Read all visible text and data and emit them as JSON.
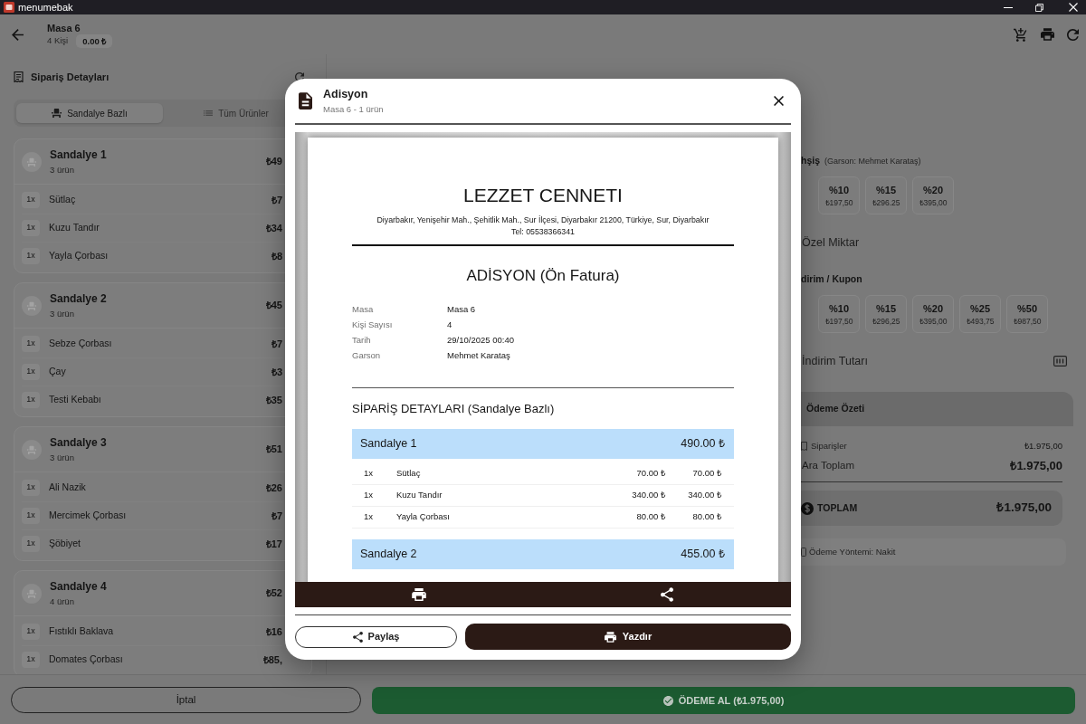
{
  "window": {
    "title": "menumebak"
  },
  "header": {
    "title": "Masa 6",
    "guests": "4 Kişi",
    "balance": "0.00 ₺"
  },
  "order_panel": {
    "title": "Sipariş Detayları",
    "tabs": [
      {
        "label": "Sandalye Bazlı",
        "selected": true
      },
      {
        "label": "Tüm Ürünler",
        "selected": false
      }
    ],
    "chairs": [
      {
        "name": "Sandalye 1",
        "count": "3 ürün",
        "total": "₺49",
        "items": [
          {
            "qty": "1x",
            "name": "Sütlaç",
            "price": "₺7"
          },
          {
            "qty": "1x",
            "name": "Kuzu Tandır",
            "price": "₺34"
          },
          {
            "qty": "1x",
            "name": "Yayla Çorbası",
            "price": "₺8"
          }
        ]
      },
      {
        "name": "Sandalye 2",
        "count": "3 ürün",
        "total": "₺45",
        "items": [
          {
            "qty": "1x",
            "name": "Sebze Çorbası",
            "price": "₺7"
          },
          {
            "qty": "1x",
            "name": "Çay",
            "price": "₺3"
          },
          {
            "qty": "1x",
            "name": "Testi Kebabı",
            "price": "₺35"
          }
        ]
      },
      {
        "name": "Sandalye 3",
        "count": "3 ürün",
        "total": "₺51",
        "items": [
          {
            "qty": "1x",
            "name": "Ali Nazik",
            "price": "₺26"
          },
          {
            "qty": "1x",
            "name": "Mercimek Çorbası",
            "price": "₺7"
          },
          {
            "qty": "1x",
            "name": "Şöbiyet",
            "price": "₺17"
          }
        ]
      },
      {
        "name": "Sandalye 4",
        "count": "4 ürün",
        "total": "₺52",
        "items": [
          {
            "qty": "1x",
            "name": "Fıstıklı Baklava",
            "price": "₺16"
          },
          {
            "qty": "1x",
            "name": "Domates Çorbası",
            "price": "₺85,"
          }
        ]
      }
    ]
  },
  "payment_panel": {
    "tip": {
      "title": "hşiş",
      "note": "(Garson: Mehmet Karataş)",
      "options": [
        {
          "label": "%10",
          "amount": "₺197,50"
        },
        {
          "label": "%15",
          "amount": "₺296.25"
        },
        {
          "label": "%20",
          "amount": "₺395,00"
        }
      ]
    },
    "custom_amount": {
      "label": "Özel Miktar"
    },
    "discount": {
      "title": "dirim / Kupon",
      "options": [
        {
          "label": "%10",
          "amount": "₺197,50"
        },
        {
          "label": "%15",
          "amount": "₺296,25"
        },
        {
          "label": "%20",
          "amount": "₺395,00"
        },
        {
          "label": "%25",
          "amount": "₺493,75"
        },
        {
          "label": "%50",
          "amount": "₺987,50"
        }
      ]
    },
    "discount_amount": {
      "label": "İndirim Tutarı"
    },
    "summary": {
      "title": "Ödeme Özeti",
      "orders_label": "Siparişler",
      "orders_value": "₺1.975,00",
      "subtotal_label": "Ara Toplam",
      "subtotal_value": "₺1.975,00",
      "total_label": "TOPLAM",
      "total_value": "₺1.975,00",
      "payment_method": "Ödeme Yöntemi: Nakit"
    }
  },
  "dialog": {
    "title": "Adisyon",
    "subtitle": "Masa 6 - 1 ürün",
    "receipt": {
      "business": "LEZZET CENNETI",
      "address": "Diyarbakır, Yenişehir Mah., Şehitlik Mah., Sur İlçesi, Diyarbakır 21200, Türkiye, Sur, Diyarbakır",
      "phone": "Tel: 05538366341",
      "heading": "ADİSYON (Ön Fatura)",
      "info": [
        {
          "label": "Masa",
          "value": "Masa 6"
        },
        {
          "label": "Kişi Sayısı",
          "value": "4"
        },
        {
          "label": "Tarih",
          "value": "29/10/2025 00:40"
        },
        {
          "label": "Garson",
          "value": "Mehmet Karataş"
        }
      ],
      "section_title": "SİPARİŞ DETAYLARI (Sandalye Bazlı)",
      "chairs": [
        {
          "name": "Sandalye 1",
          "total": "490.00 ₺",
          "items": [
            {
              "qty": "1x",
              "name": "Sütlaç",
              "unit_price": "70.00 ₺",
              "line_total": "70.00 ₺"
            },
            {
              "qty": "1x",
              "name": "Kuzu Tandır",
              "unit_price": "340.00 ₺",
              "line_total": "340.00 ₺"
            },
            {
              "qty": "1x",
              "name": "Yayla Çorbası",
              "unit_price": "80.00 ₺",
              "line_total": "80.00 ₺"
            }
          ]
        },
        {
          "name": "Sandalye 2",
          "total": "455.00 ₺"
        }
      ]
    },
    "buttons": [
      {
        "label": "Paylaş",
        "kind": "outline"
      },
      {
        "label": "Yazdır",
        "kind": "solid"
      }
    ]
  },
  "footer": {
    "buttons": [
      {
        "label": "İptal",
        "kind": "outline"
      },
      {
        "label": "ÖDEME AL (₺1.975,00)",
        "kind": "confirm"
      }
    ]
  }
}
